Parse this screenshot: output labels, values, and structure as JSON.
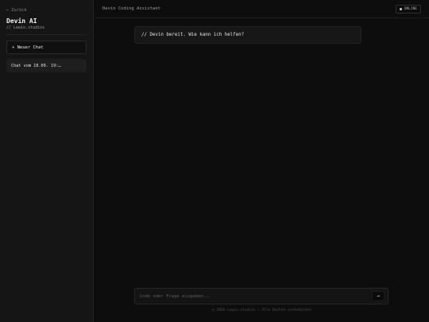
{
  "sidebar": {
    "back_label": "← Zurück",
    "title": "Devin AI",
    "subtitle": "// Lewin.studios",
    "new_chat_label": "+ Neuer Chat",
    "chats": [
      {
        "label": "Chat vom 18.09. 19:…"
      }
    ]
  },
  "header": {
    "title": "Devin Coding Assistant",
    "status": "ONLINE"
  },
  "messages": [
    {
      "text": "// Devin bereit. Wie kann ich helfen?"
    }
  ],
  "composer": {
    "placeholder": "Code oder Frage eingeben...",
    "send_icon": "arrow-right-icon",
    "send_glyph": "→"
  },
  "footer": {
    "text": "© 2026 Lewin.studios – Alle Rechte vorbehalten"
  }
}
